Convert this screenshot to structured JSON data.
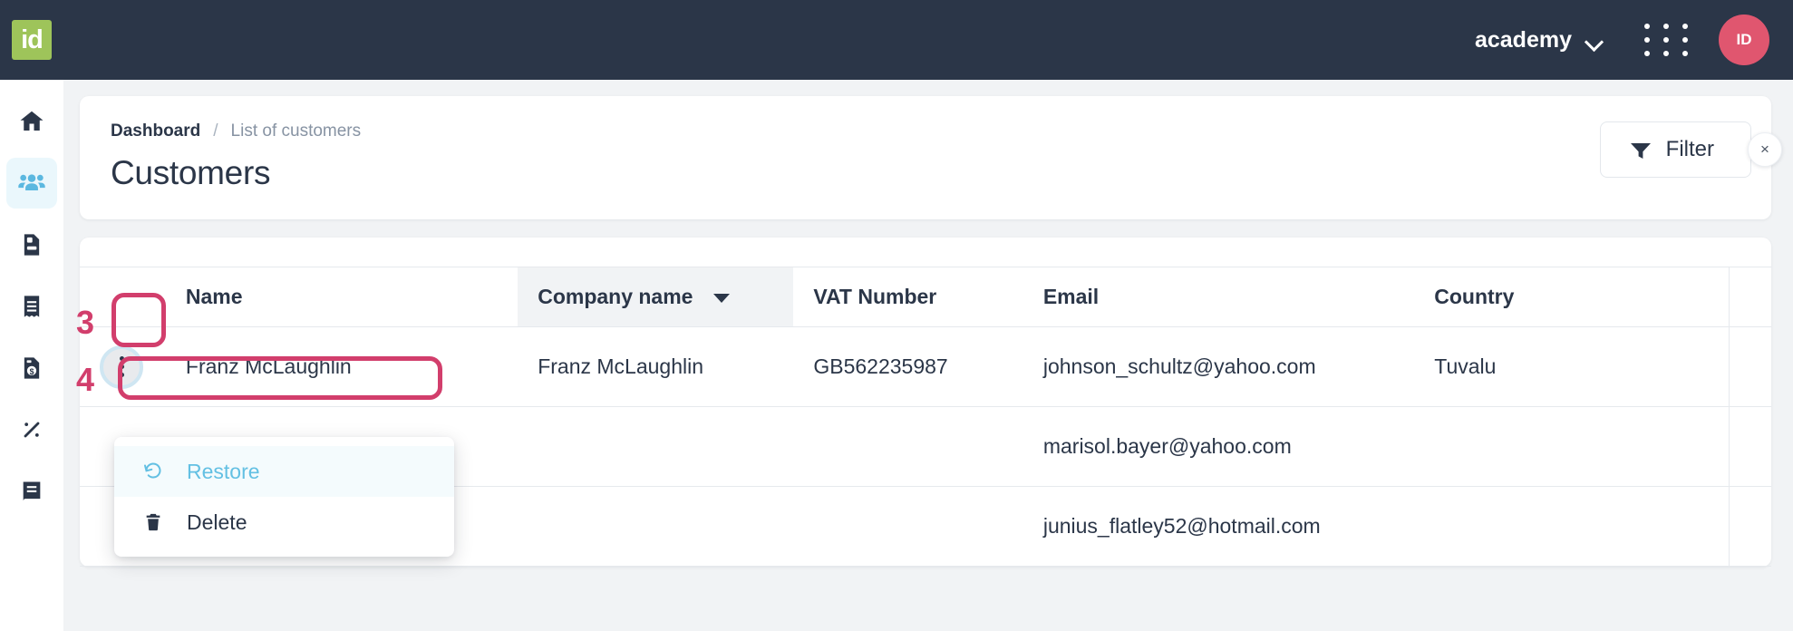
{
  "topbar": {
    "logo_text": "id",
    "org_name": "academy",
    "chevron_icon": "chevron-down-icon",
    "apps_icon": "apps-grid-icon",
    "avatar_initials": "ID",
    "bg_color": "#2b3648",
    "logo_bg_color": "#9ec45a",
    "avatar_bg_color": "#e0566f"
  },
  "sidebar": {
    "items": [
      {
        "name": "home",
        "icon": "home-icon",
        "active": false
      },
      {
        "name": "customers",
        "icon": "people-icon",
        "active": true
      },
      {
        "name": "quotes",
        "icon": "document-icon",
        "active": false
      },
      {
        "name": "receipts",
        "icon": "receipt-icon",
        "active": false
      },
      {
        "name": "invoices",
        "icon": "invoice-dollar-icon",
        "active": false
      },
      {
        "name": "taxes",
        "icon": "percent-icon",
        "active": false
      },
      {
        "name": "ledger",
        "icon": "book-icon",
        "active": false
      }
    ],
    "active_bg_color": "#eaf7fc",
    "active_icon_color": "#5bb8e0"
  },
  "header": {
    "breadcrumb": {
      "home": "Dashboard",
      "separator": "/",
      "current": "List of customers"
    },
    "title": "Customers",
    "filter": {
      "label": "Filter",
      "icon": "funnel-icon",
      "clear_icon": "close-icon",
      "clear_label": "×"
    }
  },
  "table": {
    "columns": [
      {
        "key": "menu",
        "label": "",
        "sorted": false
      },
      {
        "key": "name",
        "label": "Name",
        "sorted": false
      },
      {
        "key": "company",
        "label": "Company name",
        "sorted": true,
        "sort_icon": "caret-down-icon"
      },
      {
        "key": "vat",
        "label": "VAT Number",
        "sorted": false
      },
      {
        "key": "email",
        "label": "Email",
        "sorted": false
      },
      {
        "key": "country",
        "label": "Country",
        "sorted": false
      }
    ],
    "rows": [
      {
        "menu_icon": "kebab-menu-icon",
        "name": "Franz McLaughlin",
        "company": "Franz McLaughlin",
        "vat": "GB562235987",
        "email": "johnson_schultz@yahoo.com",
        "country": "Tuvalu"
      },
      {
        "menu_icon": "kebab-menu-icon",
        "name": "",
        "company": "",
        "vat": "",
        "email": "marisol.bayer@yahoo.com",
        "country": ""
      },
      {
        "menu_icon": "kebab-menu-icon",
        "name": "",
        "company": "",
        "vat": "",
        "email": "junius_flatley52@hotmail.com",
        "country": ""
      }
    ]
  },
  "dropdown": {
    "items": [
      {
        "label": "Restore",
        "icon": "restore-undo-icon",
        "highlighted": true,
        "color": "#63c0e3"
      },
      {
        "label": "Delete",
        "icon": "trash-icon",
        "highlighted": false,
        "color": "#2b3648"
      }
    ]
  },
  "annotations": {
    "accent_color": "#d23e6c",
    "steps": [
      {
        "number": "3",
        "target": "kebab-menu-button"
      },
      {
        "number": "4",
        "target": "restore-menu-item"
      }
    ]
  }
}
